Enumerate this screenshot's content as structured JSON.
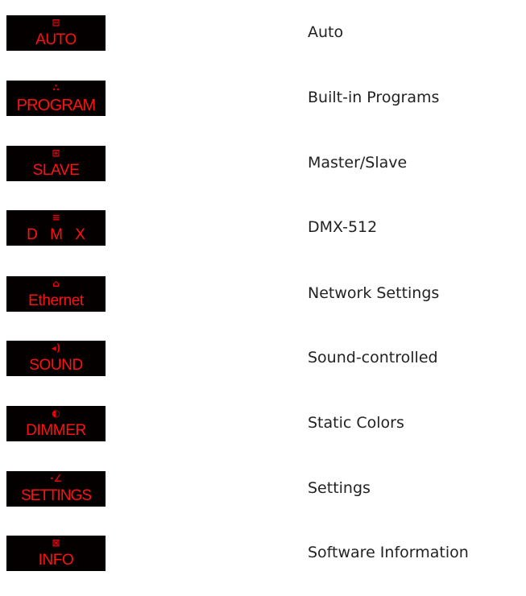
{
  "colors": {
    "tile_background": "#050000",
    "tile_text": "#ff1111",
    "description_text": "#222222"
  },
  "menu": {
    "items": [
      {
        "icon": "auto-mode-icon",
        "glyph": "⊟",
        "tile_label": "AUTO",
        "description": "Auto"
      },
      {
        "icon": "program-mode-icon",
        "glyph": "∴",
        "tile_label": "PROGRAM",
        "description": "Built-in Programs"
      },
      {
        "icon": "slave-mode-icon",
        "glyph": "⊞",
        "tile_label": "SLAVE",
        "description": "Master/Slave"
      },
      {
        "icon": "dmx-mode-icon",
        "glyph": "≡",
        "tile_label": "D M X",
        "description": "DMX-512"
      },
      {
        "icon": "ethernet-icon",
        "glyph": "⌂",
        "tile_label": "Ethernet",
        "description": "Network Settings"
      },
      {
        "icon": "sound-icon",
        "glyph": "◂)",
        "tile_label": "SOUND",
        "description": "Sound-controlled"
      },
      {
        "icon": "dimmer-icon",
        "glyph": "◐",
        "tile_label": "DIMMER",
        "description": "Static Colors"
      },
      {
        "icon": "settings-icon",
        "glyph": "∙∠",
        "tile_label": "SETTINGS",
        "description": "Settings"
      },
      {
        "icon": "info-icon",
        "glyph": "⊠",
        "tile_label": "INFO",
        "description": "Software Information"
      }
    ]
  }
}
